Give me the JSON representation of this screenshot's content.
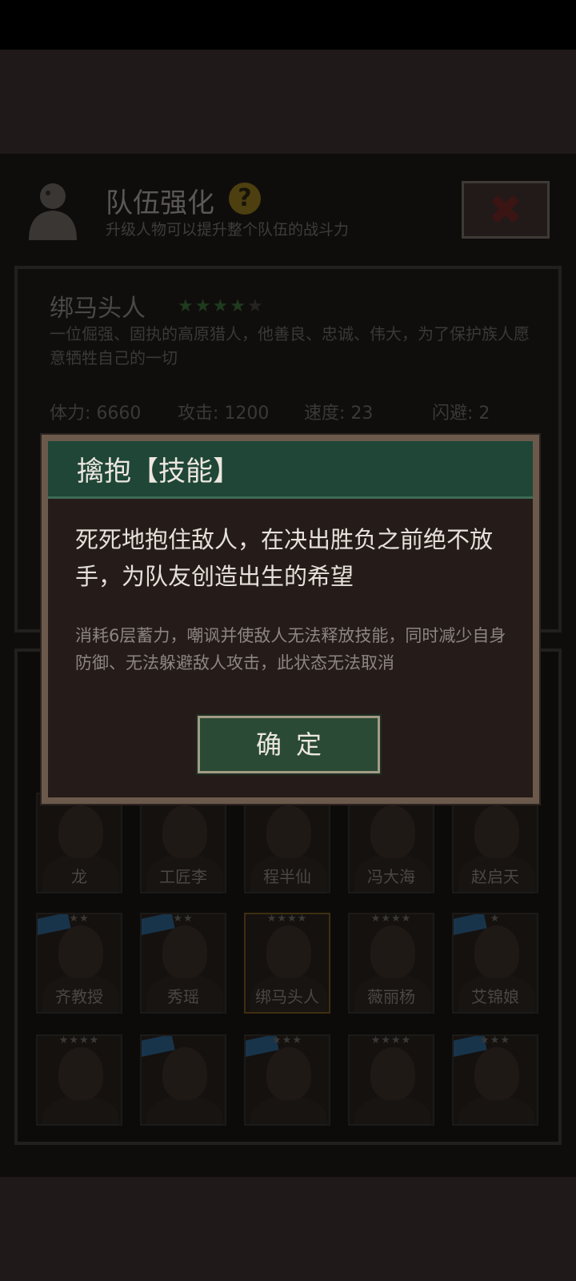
{
  "header": {
    "title": "队伍强化",
    "help_icon": "?",
    "subtitle": "升级人物可以提升整个队伍的战斗力",
    "close_glyph": "✖"
  },
  "hero": {
    "name": "绑马头人",
    "rating": 4,
    "max_rating": 5,
    "description": "一位倔强、固执的高原猎人，他善良、忠诚、伟大，为了保护族人愿意牺牲自己的一切",
    "stats": {
      "hp": "体力: 6660",
      "attack": "攻击: 1200",
      "speed": "速度: 23",
      "dodge": "闪避: 2"
    }
  },
  "characters": {
    "row1": [
      {
        "name": "龙"
      },
      {
        "name": "工匠李"
      },
      {
        "name": "程半仙"
      },
      {
        "name": "冯大海"
      },
      {
        "name": "赵启天"
      }
    ],
    "row2": [
      {
        "name": "齐教授",
        "stars": "★★"
      },
      {
        "name": "秀瑶",
        "stars": "★★"
      },
      {
        "name": "绑马头人",
        "stars": "★★★★"
      },
      {
        "name": "薇丽杨",
        "stars": "★★★★"
      },
      {
        "name": "艾锦娘",
        "stars": "★"
      }
    ],
    "row3_stars": [
      "★★★★",
      "",
      "★★★",
      "★★★★",
      "★★★"
    ]
  },
  "modal": {
    "title": "擒抱【技能】",
    "main_text": "死死地抱住敌人，在决出胜负之前绝不放手，为队友创造出生的希望",
    "detail_text": "消耗6层蓄力，嘲讽并使敌人无法释放技能，同时减少自身防御、无法躲避敌人攻击，此状态无法取消",
    "confirm_label": "确定"
  },
  "colors": {
    "modal_header": "#1f4637",
    "confirm_button": "#2a4a36",
    "star_green": "#1f3a1c",
    "help_icon": "#4d3f0f"
  }
}
